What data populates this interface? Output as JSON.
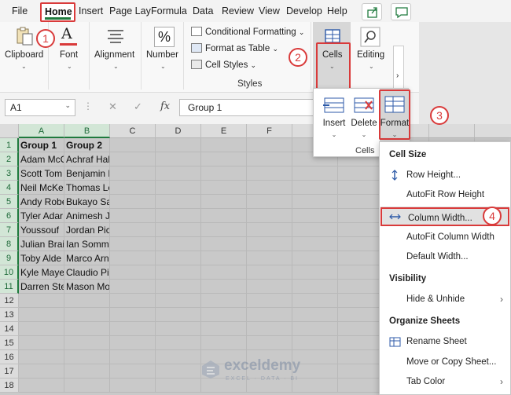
{
  "tabs": [
    "File",
    "Home",
    "Insert",
    "Page Lay",
    "Formula",
    "Data",
    "Review",
    "View",
    "Develop",
    "Help"
  ],
  "active_tab": "Home",
  "ribbon": {
    "clipboard": "Clipboard",
    "font": "Font",
    "alignment": "Alignment",
    "number": "Number",
    "conditional_formatting": "Conditional Formatting",
    "format_as_table": "Format as Table",
    "cell_styles": "Cell Styles",
    "styles_group": "Styles",
    "cells": "Cells",
    "editing": "Editing",
    "font_glyph": "A",
    "number_glyph": "%"
  },
  "formula_bar": {
    "name_box": "A1",
    "fx": "fx",
    "value": "Group 1"
  },
  "grid": {
    "columns": [
      "A",
      "B",
      "C",
      "D",
      "E",
      "F"
    ],
    "rows": [
      [
        "Group 1",
        "Group 2"
      ],
      [
        "Adam McC",
        "Achraf Hakimi"
      ],
      [
        "Scott Tom",
        "Benjamin Pavard"
      ],
      [
        "Neil McKe",
        "Thomas Lemar"
      ],
      [
        "Andy Robe",
        "Bukayo Saka"
      ],
      [
        "Tyler Adar",
        "Animesh Jain"
      ],
      [
        "Youssouf",
        "Jordan Pickford"
      ],
      [
        "Julian Brai",
        "Ian Sommar"
      ],
      [
        "Toby Alde",
        "Marco Arnautovic"
      ],
      [
        "Kyle Maye",
        "Claudio Pizzaro"
      ],
      [
        "Darren Ste",
        "Mason Mount"
      ]
    ],
    "row_numbers": [
      "1",
      "2",
      "3",
      "4",
      "5",
      "6",
      "7",
      "8",
      "9",
      "10",
      "11",
      "12",
      "13",
      "14",
      "15",
      "16",
      "17",
      "18"
    ]
  },
  "cells_popup": {
    "insert": "Insert",
    "delete": "Delete",
    "format": "Format",
    "group_label": "Cells"
  },
  "format_menu": {
    "cell_size": "Cell Size",
    "row_height": "Row Height...",
    "autofit_row": "AutoFit Row Height",
    "column_width": "Column Width...",
    "autofit_column": "AutoFit Column Width",
    "default_width": "Default Width...",
    "visibility": "Visibility",
    "hide_unhide": "Hide & Unhide",
    "organize_sheets": "Organize Sheets",
    "rename_sheet": "Rename Sheet",
    "move_copy": "Move or Copy Sheet...",
    "tab_color": "Tab Color"
  },
  "steps": [
    "1",
    "2",
    "3",
    "4"
  ],
  "watermark": {
    "name": "exceldemy",
    "sub": "EXCEL · DATA · BI"
  },
  "colors": {
    "excel_green": "#1f7a3d",
    "highlight_red": "#d93a3a",
    "grid_gray": "#c9c9c9"
  }
}
